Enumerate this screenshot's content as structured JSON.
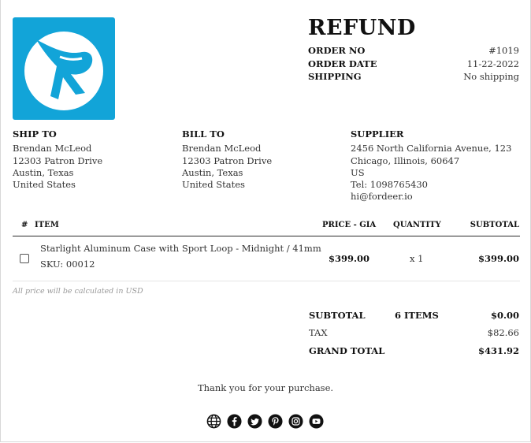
{
  "doc": {
    "title": "REFUND",
    "order_no_label": "ORDER NO",
    "order_no": "#1019",
    "order_date_label": "ORDER DATE",
    "order_date": "11-22-2022",
    "shipping_label": "SHIPPING",
    "shipping": "No shipping"
  },
  "ship_to": {
    "heading": "SHIP TO",
    "lines": [
      "Brendan McLeod",
      "12303 Patron Drive",
      "Austin, Texas",
      "United States"
    ]
  },
  "bill_to": {
    "heading": "BILL TO",
    "lines": [
      "Brendan McLeod",
      "12303 Patron Drive",
      "Austin, Texas",
      "United States"
    ]
  },
  "supplier": {
    "heading": "SUPPLIER",
    "lines": [
      "2456 North California Avenue, 123",
      "Chicago, Illinois, 60647",
      "US",
      "Tel: 1098765430",
      "hi@fordeer.io"
    ]
  },
  "table": {
    "headers": {
      "num": "#",
      "item": "ITEM",
      "price": "PRICE - GIA",
      "quantity": "QUANTITY",
      "subtotal": "SUBTOTAL"
    },
    "rows": [
      {
        "name": "Starlight Aluminum Case with Sport Loop - Midnight / 41mm",
        "sku": "SKU: 00012",
        "price": "$399.00",
        "quantity": "x 1",
        "subtotal": "$399.00"
      }
    ]
  },
  "note": "All price will be calculated in USD",
  "totals": {
    "subtotal_label": "SUBTOTAL",
    "items_count": "6 ITEMS",
    "subtotal": "$0.00",
    "tax_label": "TAX",
    "tax": "$82.66",
    "grand_total_label": "GRAND TOTAL",
    "grand_total": "$431.92"
  },
  "footer": {
    "thanks": "Thank you for your purchase.",
    "social_icons": [
      "globe-icon",
      "facebook-icon",
      "twitter-icon",
      "pinterest-icon",
      "instagram-icon",
      "youtube-icon"
    ]
  },
  "colors": {
    "logo_bg": "#12a4d8",
    "text": "#2b2b2b"
  }
}
